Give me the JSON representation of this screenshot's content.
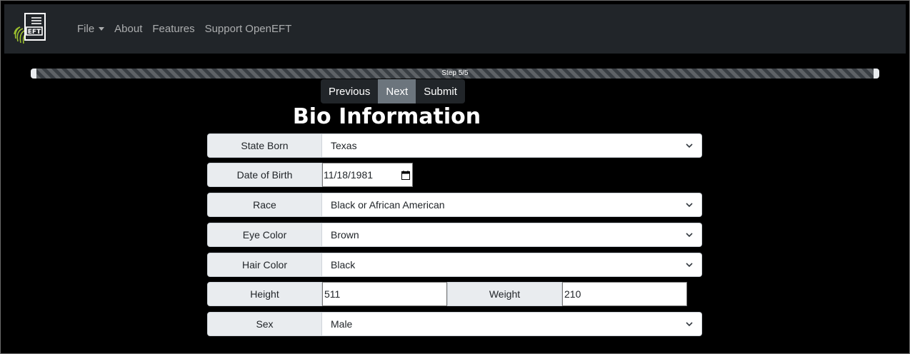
{
  "navbar": {
    "logo_text": "EFT",
    "menu": [
      {
        "label": "File",
        "has_dropdown": true
      },
      {
        "label": "About"
      },
      {
        "label": "Features"
      },
      {
        "label": "Support OpenEFT"
      }
    ]
  },
  "progress": {
    "label": "Step 5/5",
    "value": 1.0
  },
  "buttons": {
    "previous": "Previous",
    "next": "Next",
    "submit": "Submit"
  },
  "title": "Bio Information",
  "form": {
    "state_born": {
      "label": "State Born",
      "value": "Texas"
    },
    "date_of_birth": {
      "label": "Date of Birth",
      "value": "11/18/1981"
    },
    "race": {
      "label": "Race",
      "value": "Black or African American"
    },
    "eye_color": {
      "label": "Eye Color",
      "value": "Brown"
    },
    "hair_color": {
      "label": "Hair Color",
      "value": "Black"
    },
    "height": {
      "label": "Height",
      "value": "511"
    },
    "weight": {
      "label": "Weight",
      "value": "210"
    },
    "sex": {
      "label": "Sex",
      "value": "Male"
    }
  },
  "icons": [
    "eft-logo-icon",
    "chevron-down-icon",
    "calendar-icon"
  ],
  "colors": {
    "navbar": "#212529",
    "label_bg": "#e9ecef",
    "active_button": "#6c757d",
    "logo_green": "#9bbf2e"
  }
}
